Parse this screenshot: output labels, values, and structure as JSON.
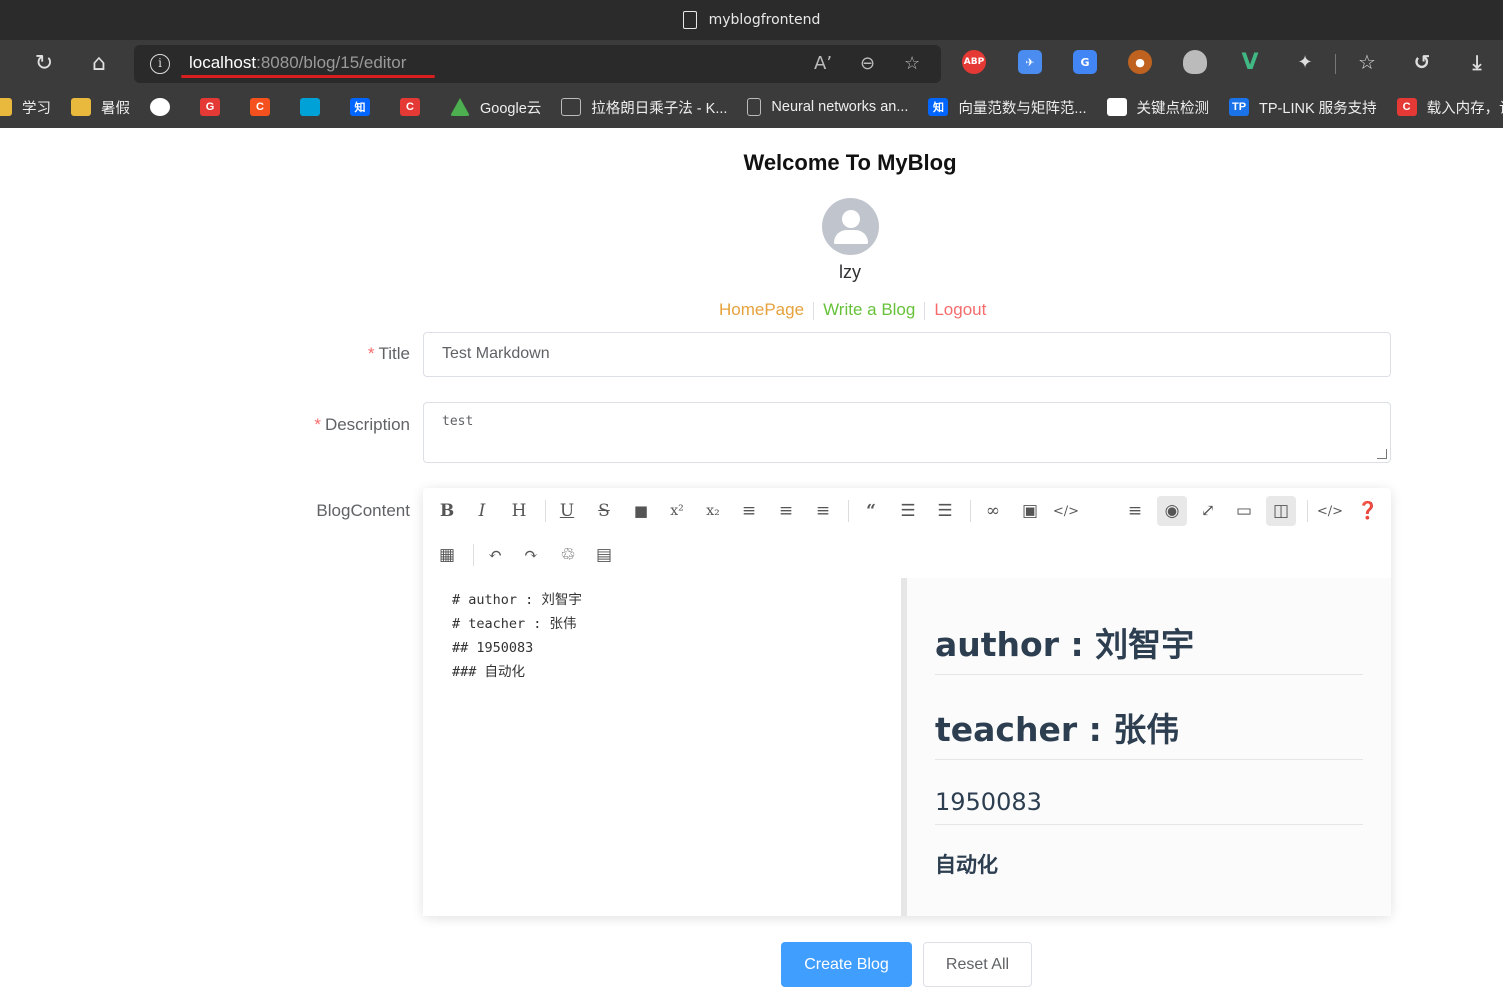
{
  "browser": {
    "tab_title": "myblogfrontend",
    "url_host": "localhost",
    "url_rest": ":8080/blog/15/editor",
    "extensions": [
      "ABP"
    ],
    "bookmarks": [
      {
        "label": "学习",
        "color": "#e8b93c"
      },
      {
        "label": "暑假",
        "color": "#e8b93c"
      },
      {
        "label": "",
        "color": "#ffffff"
      },
      {
        "label": "",
        "color": "#e53935"
      },
      {
        "label": "",
        "color": "#f4511e"
      },
      {
        "label": "",
        "color": "#00a1d6"
      },
      {
        "label": "",
        "color": "#0066ff"
      },
      {
        "label": "",
        "color": "#e53935"
      },
      {
        "label": "Google云",
        "color": "#4caf50"
      },
      {
        "label": "拉格朗日乘子法 - K...",
        "color": "#bbbbbb"
      },
      {
        "label": "Neural networks an...",
        "color": "#bbbbbb"
      },
      {
        "label": "向量范数与矩阵范...",
        "color": "#0066ff"
      },
      {
        "label": "关键点检测",
        "color": "#ffffff"
      },
      {
        "label": "TP-LINK 服务支持",
        "color": "#1a73e8"
      },
      {
        "label": "载入内存，让程序",
        "color": "#e53935"
      }
    ],
    "bookmark_glyphs": [
      "",
      "",
      "",
      "G",
      "C",
      "",
      "知",
      "C",
      "",
      "",
      "",
      "知",
      "",
      "TP",
      "C"
    ]
  },
  "page": {
    "title": "Welcome To MyBlog",
    "username": "lzy",
    "nav": {
      "home": "HomePage",
      "write": "Write a Blog",
      "logout": "Logout"
    }
  },
  "form": {
    "title_label": "Title",
    "title_value": "Test Markdown",
    "description_label": "Description",
    "description_value": "test",
    "content_label": "BlogContent",
    "markdown_lines": [
      "# author : 刘智宇",
      "# teacher : 张伟",
      "## 1950083",
      "### 自动化"
    ],
    "preview": {
      "h1_a": "author : 刘智宇",
      "h1_b": "teacher : 张伟",
      "h2": "1950083",
      "h3": "自动化"
    }
  },
  "buttons": {
    "create": "Create Blog",
    "reset": "Reset All"
  },
  "colors": {
    "primary": "#409eff",
    "required": "#f56c6c",
    "home": "#e6a23c",
    "write": "#67c23a",
    "logout": "#f56c6c"
  }
}
